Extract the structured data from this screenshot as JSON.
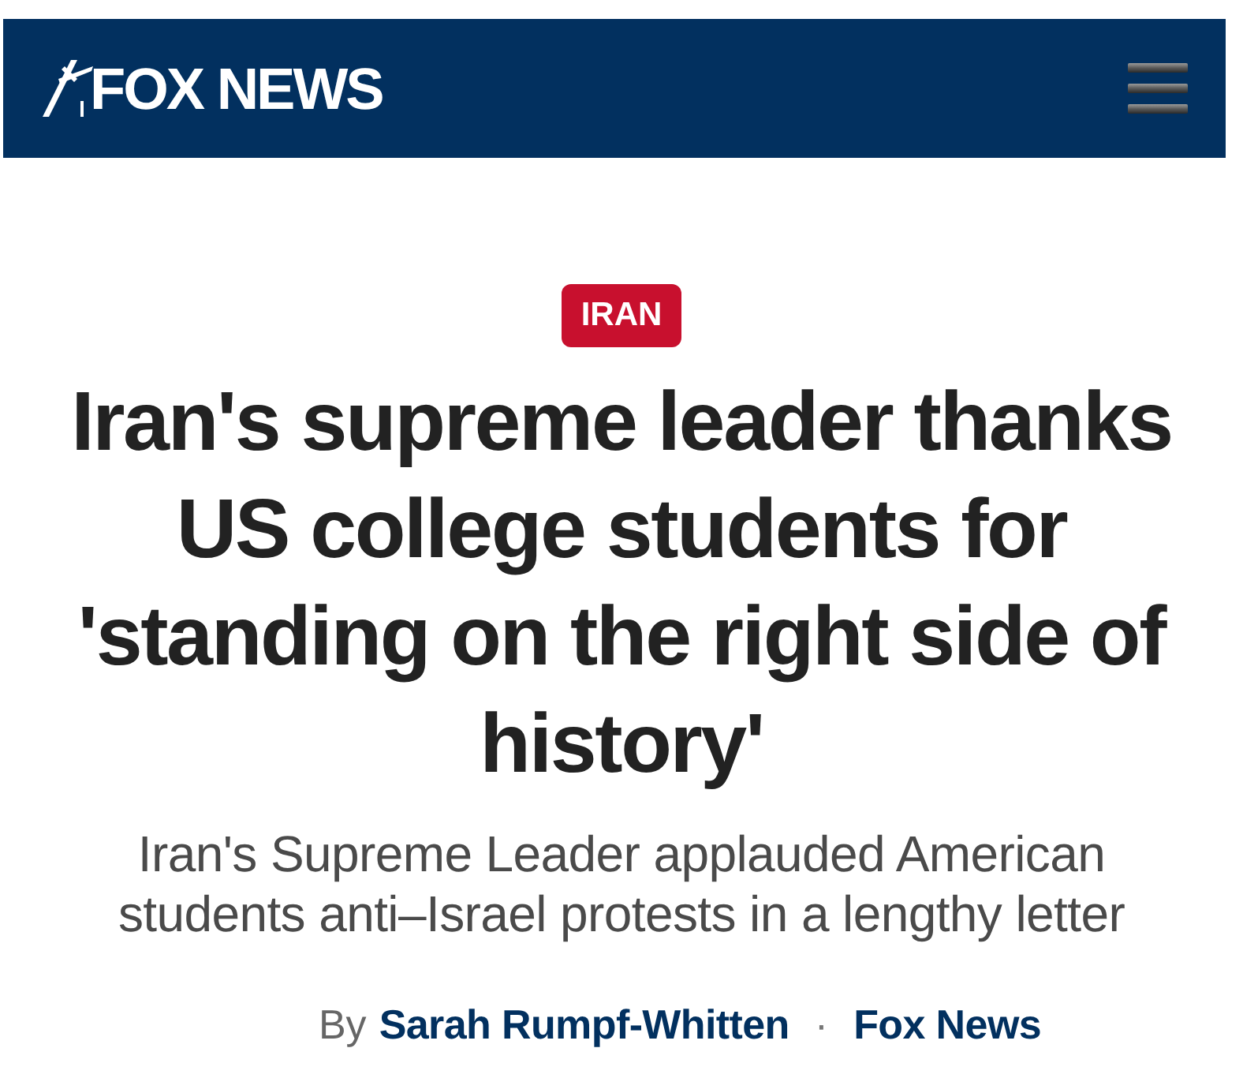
{
  "header": {
    "logo_text": "FOX NEWS"
  },
  "tag": "IRAN",
  "headline": "Iran's supreme leader thanks US college students for 'standing on the right side of history'",
  "subheadline": "Iran's Supreme Leader applauded American students anti–Israel protests in a lengthy letter",
  "byline": {
    "prefix": "By",
    "author": "Sarah Rumpf-Whitten",
    "separator": "·",
    "source": "Fox News"
  }
}
